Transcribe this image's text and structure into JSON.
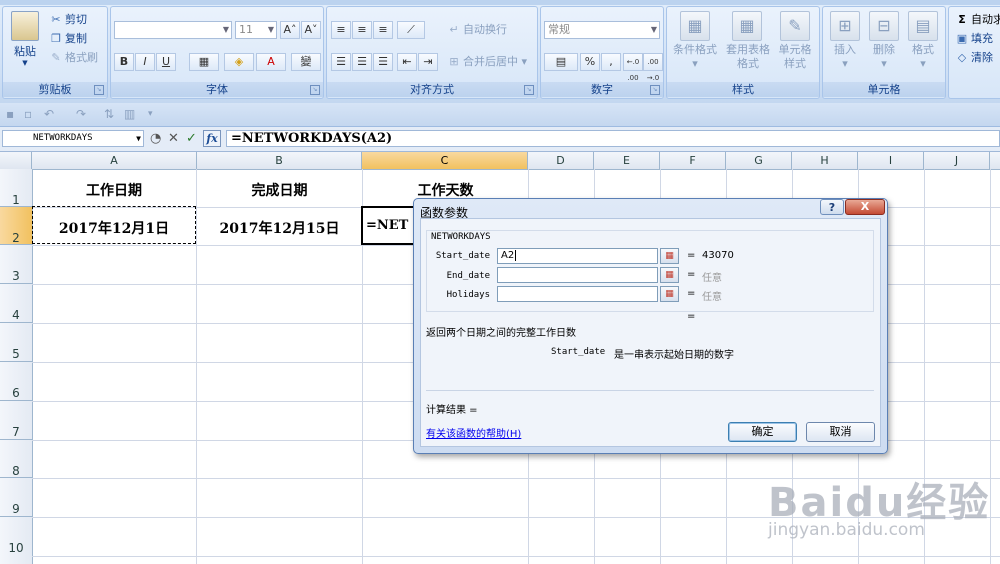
{
  "ribbon": {
    "clipboard": {
      "label": "剪贴板",
      "paste": "粘贴",
      "cut": "剪切",
      "copy": "复制",
      "format_painter": "格式刷"
    },
    "font": {
      "label": "字体",
      "font_name": "",
      "font_size": "11",
      "bold": "B",
      "italic": "I",
      "underline": "U",
      "grow": "A˄",
      "shrink": "A˅",
      "font_color": "A",
      "phonetic": "變"
    },
    "alignment": {
      "label": "对齐方式",
      "wrap_text": "自动换行",
      "merge_center": "合并后居中"
    },
    "number": {
      "label": "数字",
      "format": "常规",
      "percent": "%",
      "comma": ",",
      "inc_decimal": "←.0 .00",
      "dec_decimal": ".00 →.0"
    },
    "styles": {
      "label": "样式",
      "conditional": "条件格式",
      "table_format": "套用表格格式",
      "cell_styles": "单元格样式"
    },
    "cells": {
      "label": "单元格",
      "insert": "插入",
      "delete": "删除",
      "format": "格式"
    },
    "editing": {
      "autosum": "自动求",
      "fill": "填充",
      "clear": "清除"
    }
  },
  "formula_bar": {
    "name_box": "NETWORKDAYS",
    "formula": "=NETWORKDAYS(A2)"
  },
  "grid": {
    "columns": [
      "A",
      "B",
      "C",
      "D",
      "E",
      "F",
      "G",
      "H",
      "I",
      "J"
    ],
    "rows": [
      "1",
      "2",
      "3",
      "4",
      "5",
      "6",
      "7",
      "8",
      "9",
      "10"
    ],
    "cells": {
      "A1": "工作日期",
      "B1": "完成日期",
      "C1": "工作天数",
      "A2": "2017年12月1日",
      "B2": "2017年12月15日",
      "C2": "=NET"
    }
  },
  "dialog": {
    "title": "函数参数",
    "help_button": "?",
    "close_button": "X",
    "function_name": "NETWORKDAYS",
    "args": [
      {
        "label": "Start_date",
        "value": "A2",
        "result": "43070"
      },
      {
        "label": "End_date",
        "value": "",
        "result": "任意"
      },
      {
        "label": "Holidays",
        "value": "",
        "result": "任意"
      }
    ],
    "eq": "=",
    "formula_result_eq": "=",
    "description": "返回两个日期之间的完整工作日数",
    "arg_name": "Start_date",
    "arg_description": "是一串表示起始日期的数字",
    "calc_result_label": "计算结果 =",
    "help_link": "有关该函数的帮助(H)",
    "ok": "确定",
    "cancel": "取消"
  },
  "watermark": {
    "logo": "Baidu经验",
    "url": "jingyan.baidu.com"
  }
}
